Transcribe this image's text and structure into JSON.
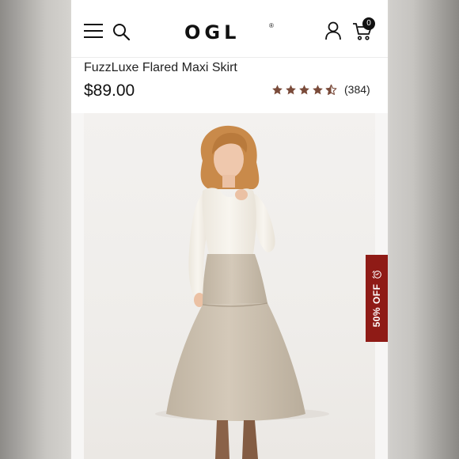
{
  "header": {
    "brand": "OGL",
    "brand_mark": "®",
    "cart_count": "0",
    "icons": [
      "menu-icon",
      "search-icon",
      "user-icon",
      "cart-icon"
    ]
  },
  "product": {
    "title": "FuzzLuxe Flared Maxi Skirt",
    "price": "$89.00",
    "rating": 4.5,
    "rating_count": "(384)",
    "image_alt": "Model wearing a cream long-sleeve top and a taupe flared maxi skirt with brown boots"
  },
  "promo": {
    "label": "50% OFF"
  },
  "colors": {
    "star": "#7a4b3a",
    "promo_bg": "#8f1b16",
    "skirt": "#cbbfae",
    "top": "#f6f3ec",
    "hair": "#c98a4a"
  }
}
